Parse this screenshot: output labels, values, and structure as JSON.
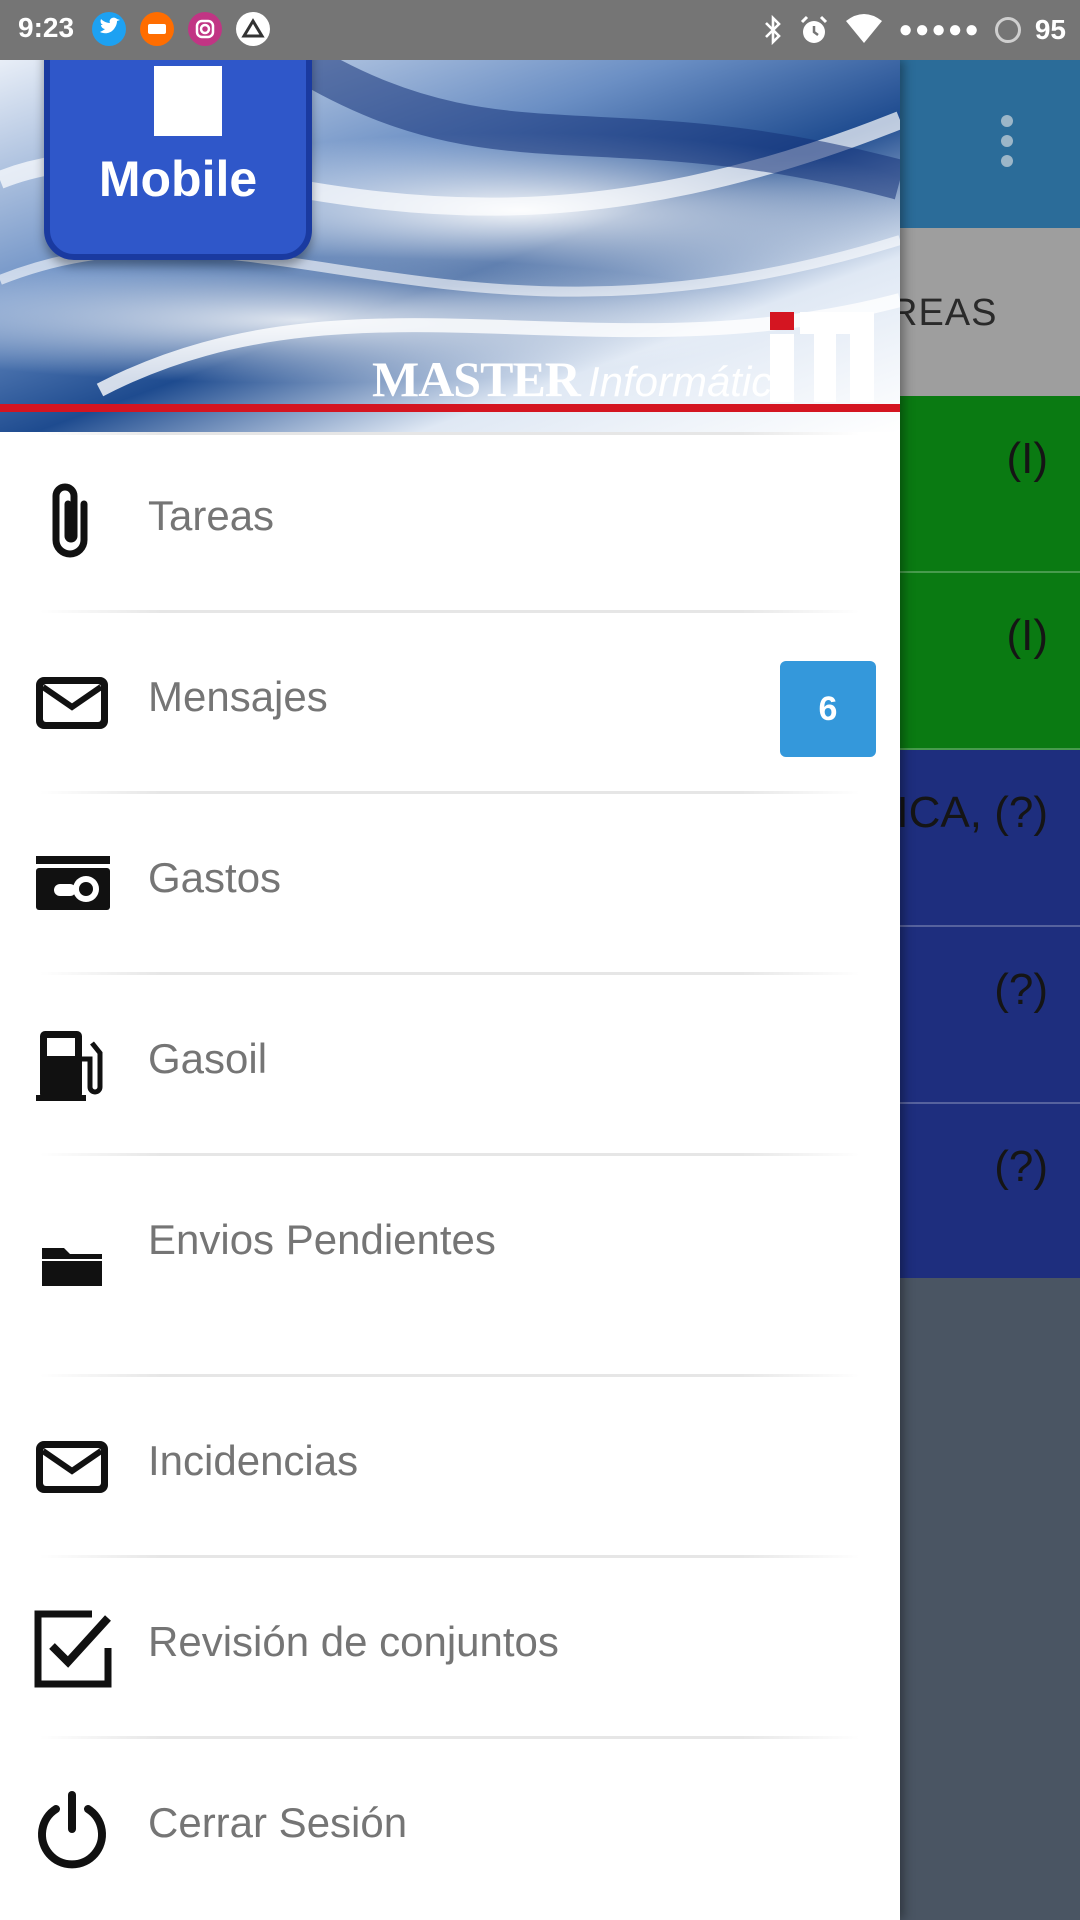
{
  "status_bar": {
    "time": "9:23",
    "apps": [
      "twitter-icon",
      "mi-icon",
      "instagram-icon",
      "drive-icon"
    ],
    "signal_dots": "●●●●●",
    "battery": "95"
  },
  "background": {
    "tab_partial": "REAS",
    "rows": [
      {
        "text": "(I)",
        "color": "#0a7a12"
      },
      {
        "text": "(I)",
        "color": "#0a7a12"
      },
      {
        "text": "ICA,  (?)",
        "color": "#1e2e7e"
      },
      {
        "text": "(?)",
        "color": "#1e2e7e"
      },
      {
        "text": "(?)",
        "color": "#1e2e7e"
      }
    ]
  },
  "header": {
    "logo_text": "Mobile",
    "brand_master": "MASTER",
    "brand_informatica": "Informática",
    "accent_red": "#d41521"
  },
  "menu": {
    "items": [
      {
        "label": "Tareas",
        "icon": "paperclip-icon"
      },
      {
        "label": "Mensajes",
        "icon": "envelope-icon",
        "badge": "6"
      },
      {
        "label": "Gastos",
        "icon": "money-icon"
      },
      {
        "label": "Gasoil",
        "icon": "fuel-pump-icon"
      },
      {
        "label": "Envios Pendientes",
        "icon": "folder-icon"
      },
      {
        "label": "Incidencias",
        "icon": "envelope-icon"
      },
      {
        "label": "Revisión de conjuntos",
        "icon": "checkbox-icon"
      },
      {
        "label": "Cerrar Sesión",
        "icon": "power-icon"
      }
    ],
    "badge_color": "#3498db"
  }
}
